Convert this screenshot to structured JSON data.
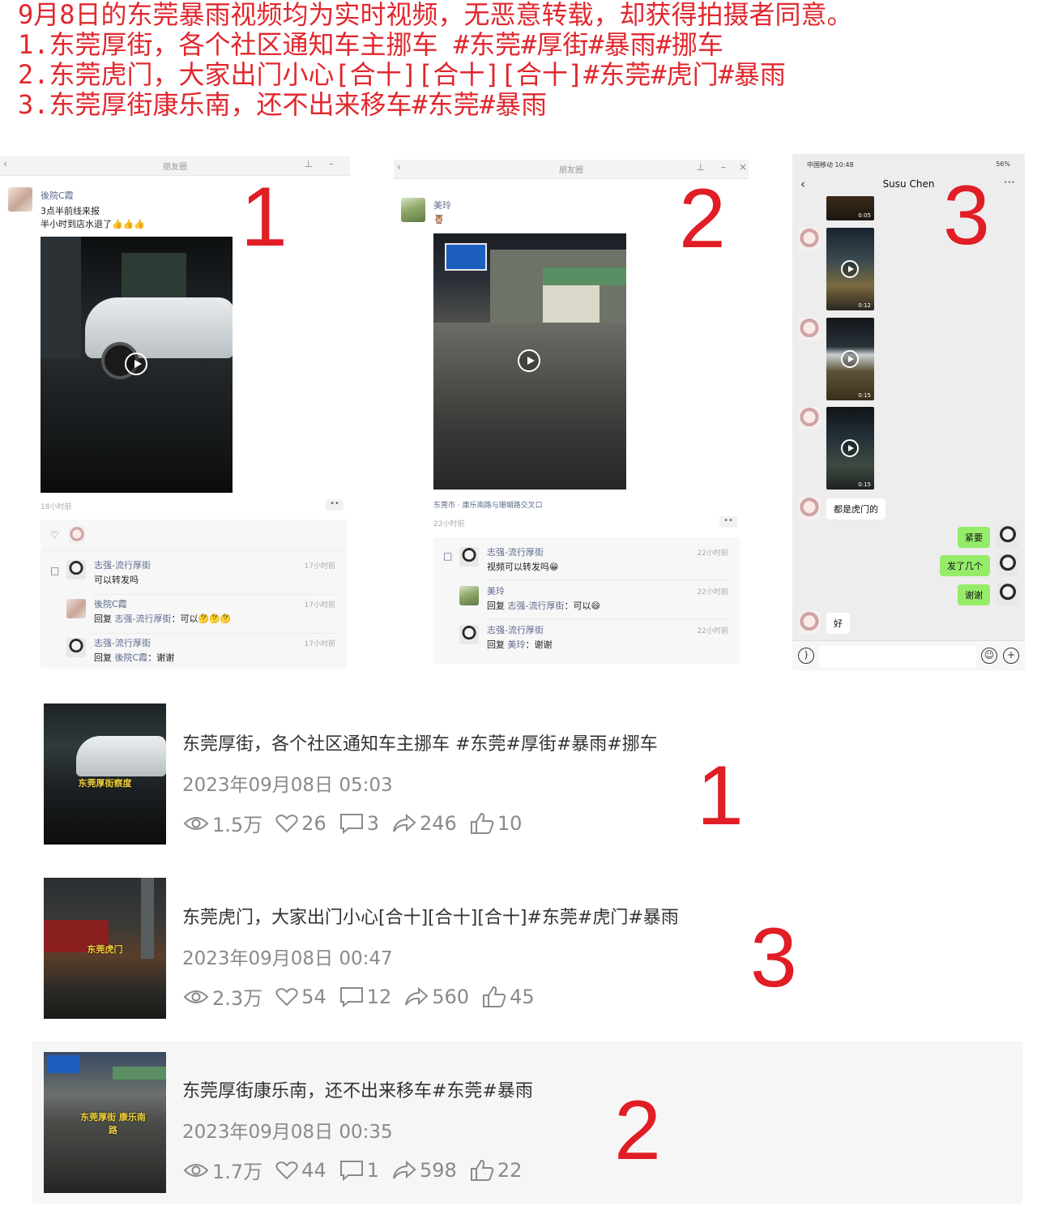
{
  "header": {
    "line1": "9月8日的东莞暴雨视频均为实时视频，无恶意转载，却获得拍摄者同意。",
    "line2": "1.东莞厚街，各个社区通知车主挪车 #东莞#厚街#暴雨#挪车",
    "line3": "2.东莞虎门，大家出门小心[合十][合十][合十]#东莞#虎门#暴雨",
    "line4": "3.东莞厚街康乐南，还不出来移车#东莞#暴雨"
  },
  "panel_numbers": {
    "p1": "1",
    "p2": "2",
    "p3": "3"
  },
  "moments1": {
    "window_title": "朋友圈",
    "author": "後院C霞",
    "text_line1": "3点半前线来报",
    "text_line2": "半小时到店水退了👍👍👍",
    "time": "18小时前",
    "comments": [
      {
        "name": "志强-流行厚街",
        "text": "可以转发吗",
        "time": "17小时前"
      },
      {
        "name": "後院C霞",
        "reply_prefix": "回复",
        "reply_to": "志强-流行厚街",
        "text": "：可以🤔🤔🤔",
        "time": "17小时前"
      },
      {
        "name": "志强-流行厚街",
        "reply_prefix": "回复",
        "reply_to": "後院C霞",
        "text": "：谢谢",
        "time": "17小时前"
      }
    ]
  },
  "moments2": {
    "window_title": "朋友圈",
    "author": "美玲",
    "text": "🦉",
    "location": "东莞市 · 康乐南路与珊瑚路交叉口",
    "time": "22小时前",
    "comments": [
      {
        "name": "志强-流行厚街",
        "text": "视频可以转发吗😁",
        "time": "22小时前"
      },
      {
        "name": "美玲",
        "reply_prefix": "回复",
        "reply_to": "志强-流行厚街",
        "text": "：可以😄",
        "time": "22小时前"
      },
      {
        "name": "志强-流行厚街",
        "reply_prefix": "回复",
        "reply_to": "美玲",
        "text": "：谢谢",
        "time": "22小时前"
      }
    ]
  },
  "chat": {
    "status_left": "中国移动 10:48",
    "status_right": "56%",
    "title": "Susu Chen",
    "videos": [
      {
        "duration": "0:05"
      },
      {
        "duration": "0:12"
      },
      {
        "duration": "0:15"
      },
      {
        "duration": "0:15"
      }
    ],
    "messages": [
      {
        "side": "left",
        "text": "都是虎门的"
      },
      {
        "side": "right",
        "text": "紧要"
      },
      {
        "side": "right",
        "text": "发了几个"
      },
      {
        "side": "right",
        "text": "谢谢"
      },
      {
        "side": "left",
        "text": "好"
      }
    ]
  },
  "videos": [
    {
      "thumb_caption": "东莞厚街察度",
      "title": "东莞厚街，各个社区通知车主挪车 #东莞#厚街#暴雨#挪车",
      "date": "2023年09月08日 05:03",
      "views": "1.5万",
      "likes": "26",
      "comments": "3",
      "shares": "246",
      "thumbs": "10",
      "marker": "1"
    },
    {
      "thumb_caption": "东莞虎门",
      "title": "东莞虎门，大家出门小心[合十][合十][合十]#东莞#虎门#暴雨",
      "date": "2023年09月08日 00:47",
      "views": "2.3万",
      "likes": "54",
      "comments": "12",
      "shares": "560",
      "thumbs": "45",
      "marker": "3"
    },
    {
      "thumb_caption": "东莞厚街 康乐南路",
      "title": "东莞厚街康乐南，还不出来移车#东莞#暴雨",
      "date": "2023年09月08日 00:35",
      "views": "1.7万",
      "likes": "44",
      "comments": "1",
      "shares": "598",
      "thumbs": "22",
      "marker": "2"
    }
  ],
  "colors": {
    "annotation_red": "#e0282e",
    "link_blue": "#5b6a8d",
    "chat_green": "#95ec69"
  }
}
